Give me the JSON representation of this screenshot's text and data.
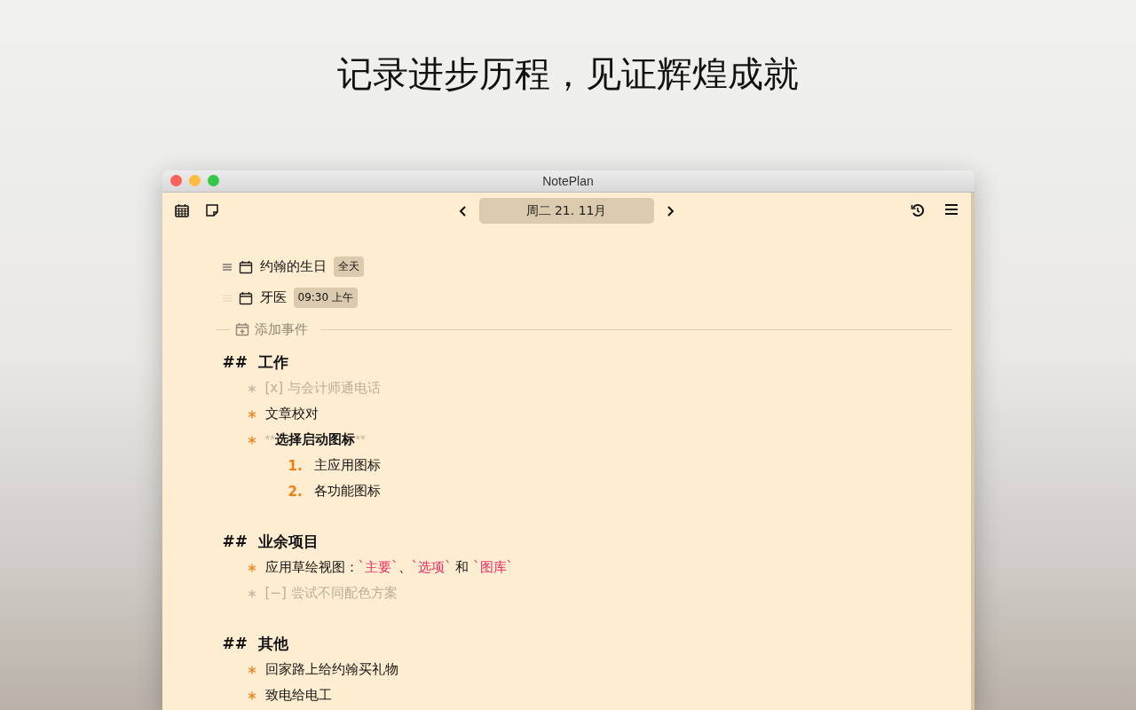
{
  "headline": "记录进步历程，见证辉煌成就",
  "window": {
    "title": "NotePlan"
  },
  "toolbar": {
    "date": "周二 21. 11月"
  },
  "events": [
    {
      "title": "约翰的生日",
      "time": "全天",
      "hovered": true
    },
    {
      "title": "牙医",
      "time": "09:30 上午",
      "hovered": false
    }
  ],
  "add_event": "添加事件",
  "sections": [
    {
      "marker": "##",
      "title": "工作",
      "items": [
        {
          "kind": "task",
          "done": true,
          "cancelled": false,
          "parts": [
            {
              "kind": "plain",
              "text": "[x] 与会计师通电话"
            }
          ]
        },
        {
          "kind": "task",
          "done": false,
          "cancelled": false,
          "parts": [
            {
              "kind": "plain",
              "text": "文章校对"
            }
          ]
        },
        {
          "kind": "task",
          "done": false,
          "cancelled": false,
          "parts": [
            {
              "kind": "syntax",
              "text": "**"
            },
            {
              "kind": "bold",
              "text": "选择启动图标"
            },
            {
              "kind": "syntax",
              "text": "**"
            }
          ]
        },
        {
          "kind": "numbered",
          "number": "1.",
          "parts": [
            {
              "kind": "plain",
              "text": "主应用图标"
            }
          ]
        },
        {
          "kind": "numbered",
          "number": "2.",
          "parts": [
            {
              "kind": "plain",
              "text": "各功能图标"
            }
          ]
        }
      ]
    },
    {
      "marker": "##",
      "title": "业余项目",
      "items": [
        {
          "kind": "task",
          "done": false,
          "cancelled": false,
          "parts": [
            {
              "kind": "plain",
              "text": "应用草绘视图："
            },
            {
              "kind": "code",
              "text": "`主要`"
            },
            {
              "kind": "plain",
              "text": "、"
            },
            {
              "kind": "code",
              "text": "`选项`"
            },
            {
              "kind": "plain",
              "text": " 和 "
            },
            {
              "kind": "code",
              "text": "`图库`"
            }
          ]
        },
        {
          "kind": "task",
          "done": false,
          "cancelled": true,
          "parts": [
            {
              "kind": "plain",
              "text": "[−] 尝试不同配色方案"
            }
          ]
        }
      ]
    },
    {
      "marker": "##",
      "title": "其他",
      "items": [
        {
          "kind": "task",
          "done": false,
          "cancelled": false,
          "parts": [
            {
              "kind": "plain",
              "text": "回家路上给约翰买礼物"
            }
          ]
        },
        {
          "kind": "task",
          "done": false,
          "cancelled": false,
          "parts": [
            {
              "kind": "plain",
              "text": "致电给电工"
            }
          ]
        }
      ]
    }
  ]
}
